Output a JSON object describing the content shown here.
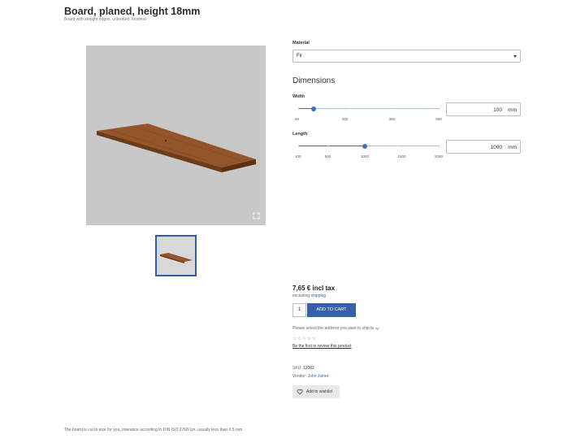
{
  "product": {
    "title": "Board, planed, height 18mm",
    "subtitle": "Board with straight edges, untreated, knotless"
  },
  "gallery": {
    "fullscreen_icon": "fullscreen-icon",
    "thumbnail_count": 1
  },
  "material": {
    "label": "Material",
    "value": "Fir"
  },
  "dimensions": {
    "title": "Dimensions",
    "width": {
      "label": "Width",
      "value": "100",
      "unit": "mm",
      "min": 50,
      "max": 500,
      "current": 100,
      "ticks": [
        "50",
        "200",
        "350",
        "500"
      ],
      "tick_values": [
        50,
        200,
        350,
        500
      ]
    },
    "length": {
      "label": "Length",
      "value": "1000",
      "unit": "mm",
      "min": 100,
      "max": 2000,
      "current": 1000,
      "ticks": [
        "100",
        "500",
        "1000",
        "1500",
        "2000"
      ],
      "tick_values": [
        100,
        500,
        1000,
        1500,
        2000
      ]
    }
  },
  "purchase": {
    "price": "7,65 € incl tax",
    "tax_prefix": "excluding",
    "tax_link": "shipping",
    "quantity": "1",
    "add_to_cart": "ADD TO CART",
    "ship_note": "Please select the address you want to ship to",
    "stars": "☆☆☆☆☆",
    "review_link": "Be the first to review this product",
    "sku_label": "SKU:",
    "sku": "12002",
    "vendor_label": "Vendor:",
    "vendor": "John Joiner",
    "wishlist": "Add to wishlist"
  },
  "footnote": "The board is cut to size for you, tolerance according to DIN ISO 2768-1m, usually less than 0.5 mm.",
  "colors": {
    "accent": "#3561a8",
    "image_bg": "#c8c8c8",
    "wood": "#8a4f1e"
  }
}
